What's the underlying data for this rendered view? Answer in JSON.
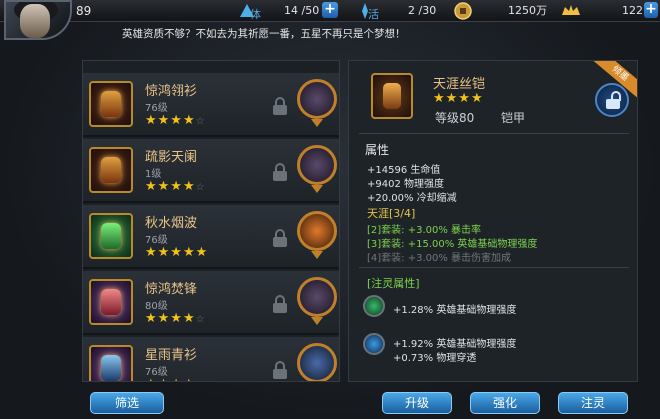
{
  "player": {
    "level": "89"
  },
  "resources": [
    {
      "label": "体",
      "value": "14 /50",
      "icon": "stamina-icon"
    },
    {
      "label": "活",
      "value": "2 /30",
      "icon": "activity-icon"
    },
    {
      "label": "",
      "value": "1250万",
      "icon": "coin-icon"
    },
    {
      "label": "",
      "value": "122",
      "icon": "ingot-icon"
    }
  ],
  "notice": "英雄资质不够？不如去为其祈愿一番，五星不再只是个梦想！",
  "equipment_list": [
    {
      "name": "惊鸿翎衫",
      "level": "76级",
      "stars": 4
    },
    {
      "name": "疏影天阑",
      "level": "1级",
      "stars": 4
    },
    {
      "name": "秋水烟波",
      "level": "76级",
      "stars": 5
    },
    {
      "name": "惊鸿焚锋",
      "level": "80级",
      "stars": 4
    },
    {
      "name": "星雨青衫",
      "level": "76级",
      "stars": 4
    }
  ],
  "detail": {
    "name": "天涯丝铠",
    "stars": 4,
    "level": "等级80",
    "type": "铠甲",
    "ribbon": "倾墨",
    "attr_title": "属性",
    "attrs": [
      "+14596 生命值",
      "+9402 物理强度",
      "+20.00% 冷却缩减"
    ],
    "set_title": "天涯[3/4]",
    "set_bonuses": [
      {
        "text": "[2]套装: +3.00% 暴击率",
        "active": true
      },
      {
        "text": "[3]套装: +15.00% 英雄基础物理强度",
        "active": true
      },
      {
        "text": "[4]套装: +3.00% 暴击伤害加成",
        "active": false
      }
    ],
    "soul_title": "[注灵属性]",
    "soul_1": "+1.28% 英雄基础物理强度",
    "soul_2a": "+1.92% 英雄基础物理强度",
    "soul_2b": "+0.73% 物理穿透"
  },
  "buttons": {
    "filter": "筛选",
    "upgrade": "升级",
    "enhance": "强化",
    "infuse": "注灵"
  },
  "colors": {
    "star": "#f2c21a",
    "accent": "#3b8fd8",
    "gold_text": "#e9c48a"
  }
}
